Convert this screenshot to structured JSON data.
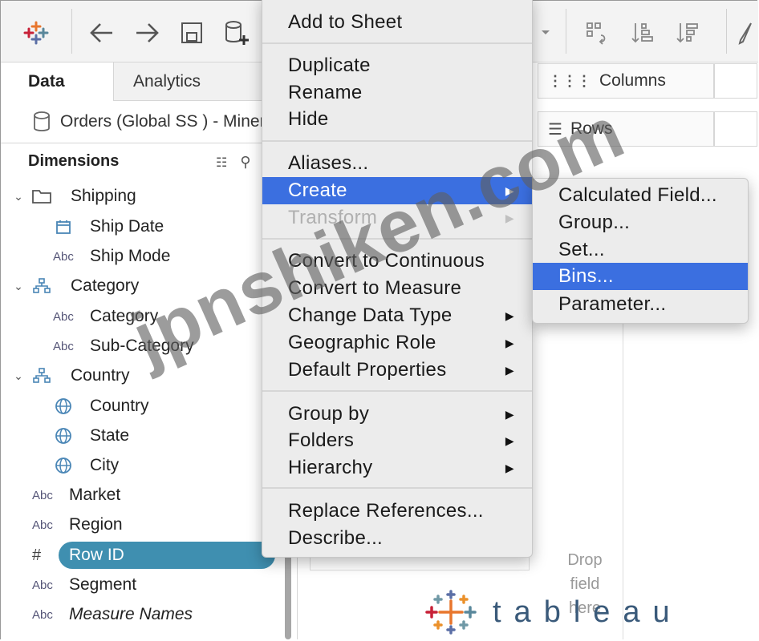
{
  "toolbar": {
    "icons": [
      "tableau-logo-icon",
      "back-arrow-icon",
      "forward-arrow-icon",
      "save-icon",
      "new-datasource-icon",
      "dropdown-arrow-icon",
      "swap-icon",
      "sort-ascending-icon",
      "sort-descending-icon",
      "pen-icon"
    ]
  },
  "left_panel": {
    "tabs": [
      "Data",
      "Analytics"
    ],
    "datasource": "Orders (Global SS ) - Minervas",
    "dimensions_header": "Dimensions",
    "fields": [
      {
        "label": "Shipping",
        "type": "folder"
      },
      {
        "label": "Ship Date",
        "type": "date"
      },
      {
        "label": "Ship Mode",
        "type": "Abc"
      },
      {
        "label": "Category",
        "type": "hierarchy"
      },
      {
        "label": "Category",
        "type": "Abc"
      },
      {
        "label": "Sub-Category",
        "type": "Abc"
      },
      {
        "label": "Country",
        "type": "hierarchy"
      },
      {
        "label": "Country",
        "type": "geo"
      },
      {
        "label": "State",
        "type": "geo"
      },
      {
        "label": "City",
        "type": "geo"
      },
      {
        "label": "Market",
        "type": "Abc"
      },
      {
        "label": "Region",
        "type": "Abc"
      },
      {
        "label": "Row ID",
        "type": "#"
      },
      {
        "label": "Segment",
        "type": "Abc"
      },
      {
        "label": "Measure Names",
        "type": "Abc"
      }
    ],
    "abc_label": "Abc",
    "hash_label": "#"
  },
  "shelves": {
    "columns": "Columns",
    "rows": "Rows"
  },
  "canvas": {
    "drop_hint": "Drop field here"
  },
  "context_menu": {
    "items": [
      "Add to Sheet",
      "Duplicate",
      "Rename",
      "Hide",
      "Aliases...",
      "Create",
      "Transform",
      "Convert to Continuous",
      "Convert to Measure",
      "Change Data Type",
      "Geographic Role",
      "Default Properties",
      "Group by",
      "Folders",
      "Hierarchy",
      "Replace References...",
      "Describe..."
    ],
    "selected": "Create",
    "disabled": [
      "Transform"
    ]
  },
  "submenu": {
    "items": [
      "Calculated Field...",
      "Group...",
      "Set...",
      "Bins...",
      "Parameter..."
    ],
    "selected": "Bins..."
  },
  "watermark": "jpnshiken.com",
  "brand": {
    "logo_text": "tableau",
    "highlight_color": "#3f8fb0",
    "menu_select_color": "#3b6fe0"
  }
}
